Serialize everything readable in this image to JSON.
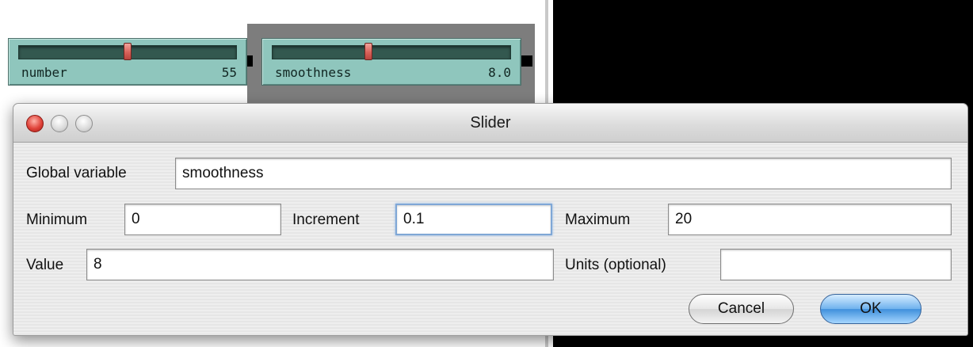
{
  "background": {
    "sliders": [
      {
        "name": "number",
        "value": "55",
        "level": 0.5,
        "selected": false
      },
      {
        "name": "smoothness",
        "value": "8.0",
        "level": 0.4,
        "selected": true
      }
    ]
  },
  "dialog": {
    "title": "Slider",
    "fields": {
      "global_variable": {
        "label": "Global variable",
        "value": "smoothness"
      },
      "minimum": {
        "label": "Minimum",
        "value": "0"
      },
      "increment": {
        "label": "Increment",
        "value": "0.1"
      },
      "maximum": {
        "label": "Maximum",
        "value": "20"
      },
      "value": {
        "label": "Value",
        "value": "8"
      },
      "units": {
        "label": "Units (optional)",
        "value": ""
      }
    },
    "buttons": {
      "cancel": "Cancel",
      "ok": "OK"
    }
  },
  "icons": [
    "close-window-icon",
    "minimize-window-icon",
    "zoom-window-icon"
  ],
  "colors": {
    "slider_body": "#8fc6bd",
    "slider_track": "#33584f",
    "thumb": "#d8625a",
    "ok_button": "#3f8fdc"
  }
}
